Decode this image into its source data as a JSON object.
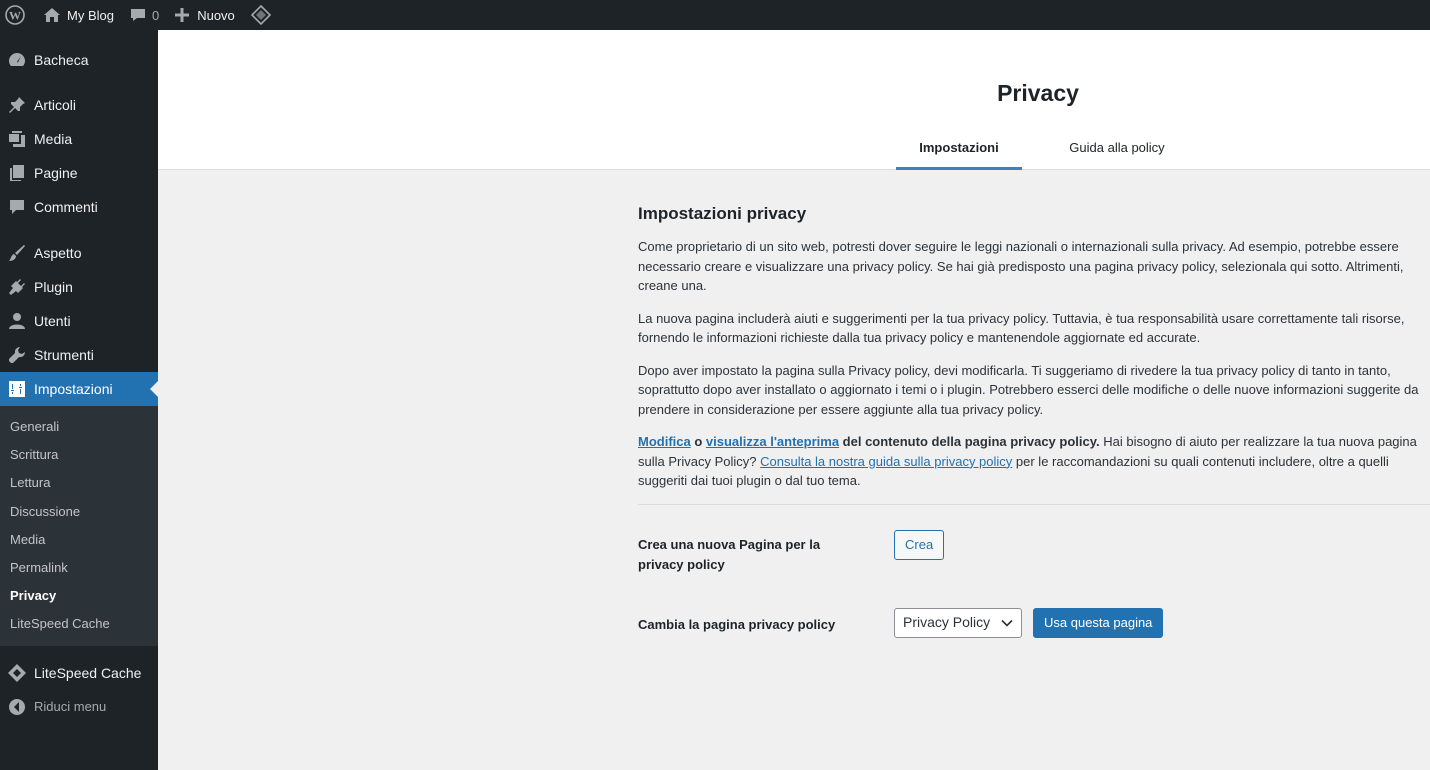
{
  "adminbar": {
    "site_name": "My Blog",
    "comments_count": "0",
    "new_label": "Nuovo"
  },
  "sidebar": {
    "items": [
      {
        "label": "Bacheca",
        "icon": "dashboard-icon"
      },
      {
        "label": "Articoli",
        "icon": "pin-icon"
      },
      {
        "label": "Media",
        "icon": "media-icon"
      },
      {
        "label": "Pagine",
        "icon": "pages-icon"
      },
      {
        "label": "Commenti",
        "icon": "comment-icon"
      },
      {
        "label": "Aspetto",
        "icon": "brush-icon"
      },
      {
        "label": "Plugin",
        "icon": "plugin-icon"
      },
      {
        "label": "Utenti",
        "icon": "user-icon"
      },
      {
        "label": "Strumenti",
        "icon": "wrench-icon"
      },
      {
        "label": "Impostazioni",
        "icon": "settings-icon"
      }
    ],
    "submenu": [
      "Generali",
      "Scrittura",
      "Lettura",
      "Discussione",
      "Media",
      "Permalink",
      "Privacy",
      "LiteSpeed Cache"
    ],
    "litespeed_label": "LiteSpeed Cache",
    "collapse_label": "Riduci menu"
  },
  "header": {
    "title": "Privacy",
    "tabs": [
      "Impostazioni",
      "Guida alla policy"
    ]
  },
  "content": {
    "heading": "Impostazioni privacy",
    "p1": "Come proprietario di un sito web, potresti dover seguire le leggi nazionali o internazionali sulla privacy. Ad esempio, potrebbe essere necessario creare e visualizzare una privacy policy. Se hai già predisposto una pagina privacy policy, selezionala qui sotto. Altrimenti, creane una.",
    "p2": "La nuova pagina includerà aiuti e suggerimenti per la tua privacy policy. Tuttavia, è tua responsabilità usare correttamente tali risorse, fornendo le informazioni richieste dalla tua privacy policy e mantenendole aggiornate ed accurate.",
    "p3": "Dopo aver impostato la pagina sulla Privacy policy, devi modificarla. Ti suggeriamo di rivedere la tua privacy policy di tanto in tanto, soprattutto dopo aver installato o aggiornato i temi o i plugin. Potrebbero esserci delle modifiche o delle nuove informazioni suggerite da prendere in considerazione per essere aggiunte alla tua privacy policy.",
    "p4_link_edit": "Modifica",
    "p4_or": " o ",
    "p4_link_view": "visualizza l'anteprima",
    "p4_bold": " del contenuto della pagina privacy policy.",
    "p4_text1": " Hai bisogno di aiuto per realizzare la tua nuova pagina sulla Privacy Policy? ",
    "p4_link_guide": "Consulta la nostra guida sulla privacy policy",
    "p4_text2": " per le raccomandazioni su quali contenuti includere, oltre a quelli suggeriti dai tuoi plugin o dal tuo tema.",
    "create_label": "Crea una nuova Pagina per la privacy policy",
    "create_button": "Crea",
    "change_label": "Cambia la pagina privacy policy",
    "select_value": "Privacy Policy",
    "use_button": "Usa questa pagina"
  },
  "colors": {
    "adminbar_bg": "#1d2327",
    "accent": "#2271b1",
    "content_bg": "#f0f0f1"
  }
}
